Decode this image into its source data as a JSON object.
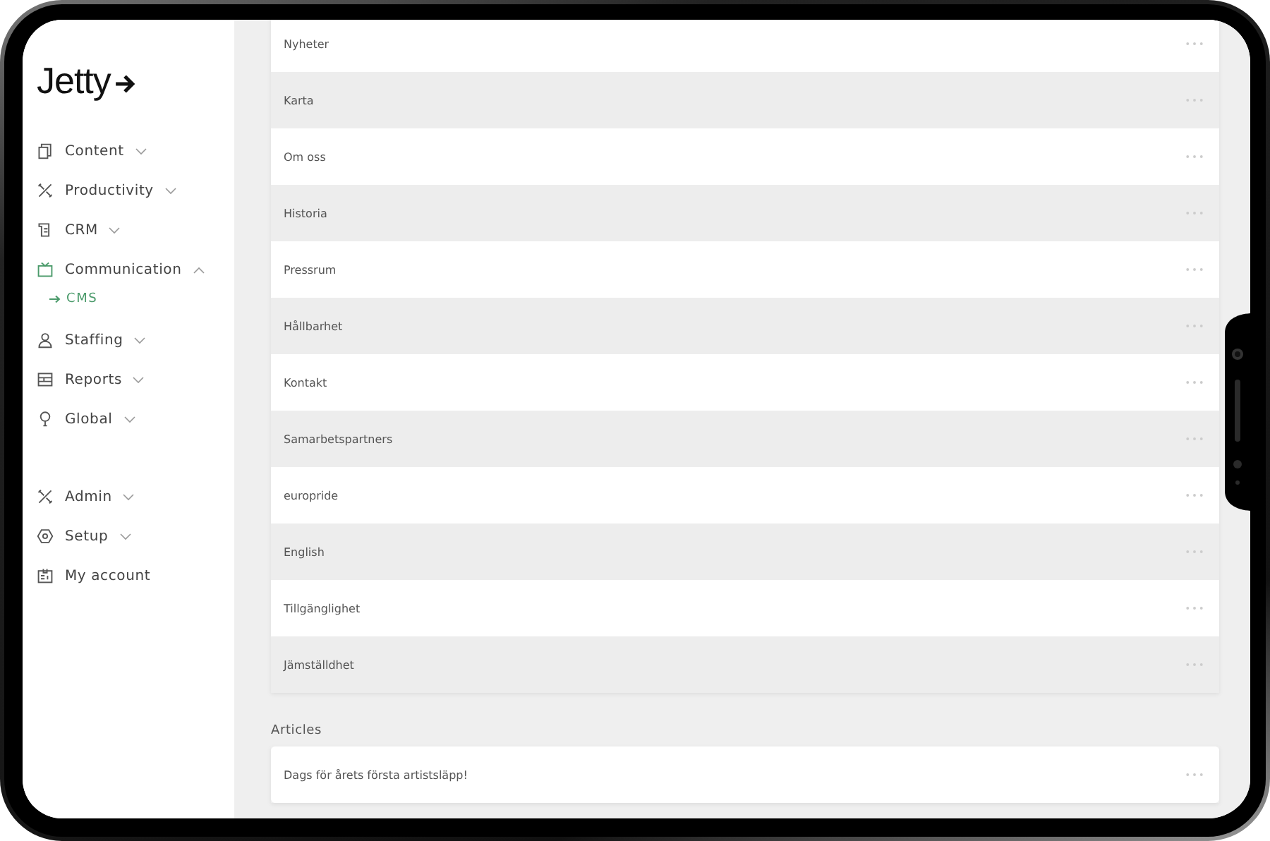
{
  "logo": {
    "text": "Jetty"
  },
  "nav": {
    "items": [
      {
        "label": "Content",
        "kind": "menu",
        "expanded": false,
        "selected": false
      },
      {
        "label": "Productivity",
        "kind": "menu",
        "expanded": false,
        "selected": false
      },
      {
        "label": "CRM",
        "kind": "menu",
        "expanded": false,
        "selected": false
      },
      {
        "label": "Communication",
        "kind": "menu",
        "expanded": true,
        "selected": true,
        "children": [
          {
            "label": "CMS",
            "selected": true
          }
        ]
      },
      {
        "label": "Staffing",
        "kind": "menu",
        "expanded": false,
        "selected": false
      },
      {
        "label": "Reports",
        "kind": "menu",
        "expanded": false,
        "selected": false
      },
      {
        "label": "Global",
        "kind": "menu",
        "expanded": false,
        "selected": false
      }
    ],
    "bottom_items": [
      {
        "label": "Admin",
        "kind": "menu",
        "expanded": false,
        "selected": false
      },
      {
        "label": "Setup",
        "kind": "menu",
        "expanded": false,
        "selected": false
      },
      {
        "label": "My account",
        "kind": "link",
        "selected": false
      }
    ]
  },
  "pages": {
    "rows": [
      {
        "title": "Nyheter"
      },
      {
        "title": "Karta"
      },
      {
        "title": "Om oss"
      },
      {
        "title": "Historia"
      },
      {
        "title": "Pressrum"
      },
      {
        "title": "Hållbarhet"
      },
      {
        "title": "Kontakt"
      },
      {
        "title": "Samarbetspartners"
      },
      {
        "title": "europride"
      },
      {
        "title": "English"
      },
      {
        "title": "Tillgänglighet"
      },
      {
        "title": "Jämställdhet"
      }
    ]
  },
  "articles": {
    "heading": "Articles",
    "rows": [
      {
        "title": "Dags för årets första artistsläpp!"
      }
    ]
  }
}
